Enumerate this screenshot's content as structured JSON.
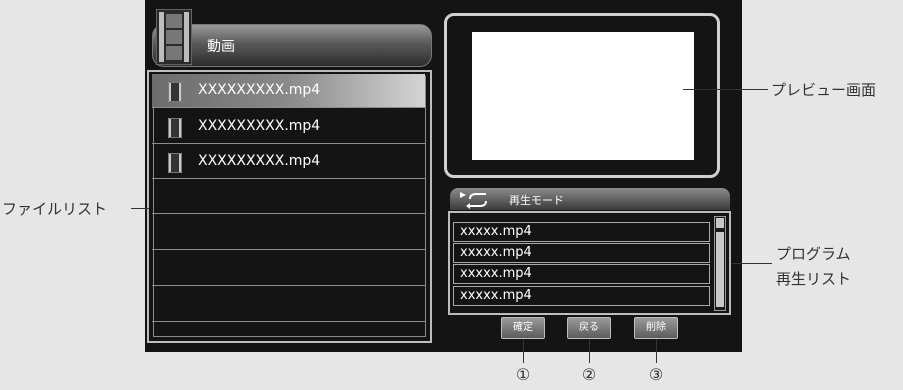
{
  "header": {
    "title": "動画",
    "icon": "film-icon"
  },
  "file_list": {
    "callout": "ファイルリスト",
    "items": [
      {
        "name": "XXXXXXXXX.mp4",
        "selected": true
      },
      {
        "name": "XXXXXXXXX.mp4",
        "selected": false
      },
      {
        "name": "XXXXXXXXX.mp4",
        "selected": false
      }
    ]
  },
  "preview": {
    "callout": "プレビュー画面"
  },
  "playlist": {
    "mode_label": "再生モード",
    "callout_line1": "プログラム",
    "callout_line2": "再生リスト",
    "items": [
      {
        "name": "xxxxx.mp4"
      },
      {
        "name": "xxxxx.mp4"
      },
      {
        "name": "xxxxx.mp4"
      },
      {
        "name": "xxxxx.mp4"
      }
    ]
  },
  "buttons": {
    "confirm": "確定",
    "back": "戻る",
    "delete": "削除"
  },
  "markers": {
    "m1": "①",
    "m2": "②",
    "m3": "③"
  },
  "colors": {
    "screen_bg": "#141414",
    "page_bg": "#e6e6e6"
  }
}
